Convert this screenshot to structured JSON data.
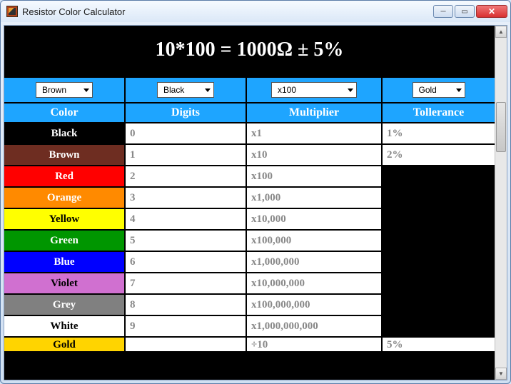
{
  "window": {
    "title": "Resistor Color Calculator"
  },
  "result": "10*100 = 1000Ω ± 5%",
  "selectors": {
    "band1": "Brown",
    "band2": "Black",
    "multiplier": "x100",
    "tolerance": "Gold"
  },
  "headers": {
    "color": "Color",
    "digits": "Digits",
    "multiplier": "Multiplier",
    "tolerance": "Tollerance"
  },
  "rows": [
    {
      "color": "Black",
      "bg": "#000000",
      "fg": "#ffffff",
      "digits": "0",
      "multiplier": "x1",
      "tolerance": "1%"
    },
    {
      "color": "Brown",
      "bg": "#6e2d21",
      "fg": "#ffffff",
      "digits": "1",
      "multiplier": "x10",
      "tolerance": "2%"
    },
    {
      "color": "Red",
      "bg": "#ff0000",
      "fg": "#ffffff",
      "digits": "2",
      "multiplier": "x100",
      "tolerance": ""
    },
    {
      "color": "Orange",
      "bg": "#ff8a00",
      "fg": "#ffffff",
      "digits": "3",
      "multiplier": "x1,000",
      "tolerance": ""
    },
    {
      "color": "Yellow",
      "bg": "#ffff00",
      "fg": "#000000",
      "digits": "4",
      "multiplier": "x10,000",
      "tolerance": ""
    },
    {
      "color": "Green",
      "bg": "#009600",
      "fg": "#ffffff",
      "digits": "5",
      "multiplier": "x100,000",
      "tolerance": ""
    },
    {
      "color": "Blue",
      "bg": "#0000ff",
      "fg": "#ffffff",
      "digits": "6",
      "multiplier": "x1,000,000",
      "tolerance": ""
    },
    {
      "color": "Violet",
      "bg": "#d070d0",
      "fg": "#000000",
      "digits": "7",
      "multiplier": "x10,000,000",
      "tolerance": ""
    },
    {
      "color": "Grey",
      "bg": "#808080",
      "fg": "#ffffff",
      "digits": "8",
      "multiplier": "x100,000,000",
      "tolerance": ""
    },
    {
      "color": "White",
      "bg": "#ffffff",
      "fg": "#000000",
      "digits": "9",
      "multiplier": "x1,000,000,000",
      "tolerance": ""
    },
    {
      "color": "Gold",
      "bg": "#ffd400",
      "fg": "#000000",
      "digits": "",
      "multiplier": "÷10",
      "tolerance": "5%"
    }
  ]
}
